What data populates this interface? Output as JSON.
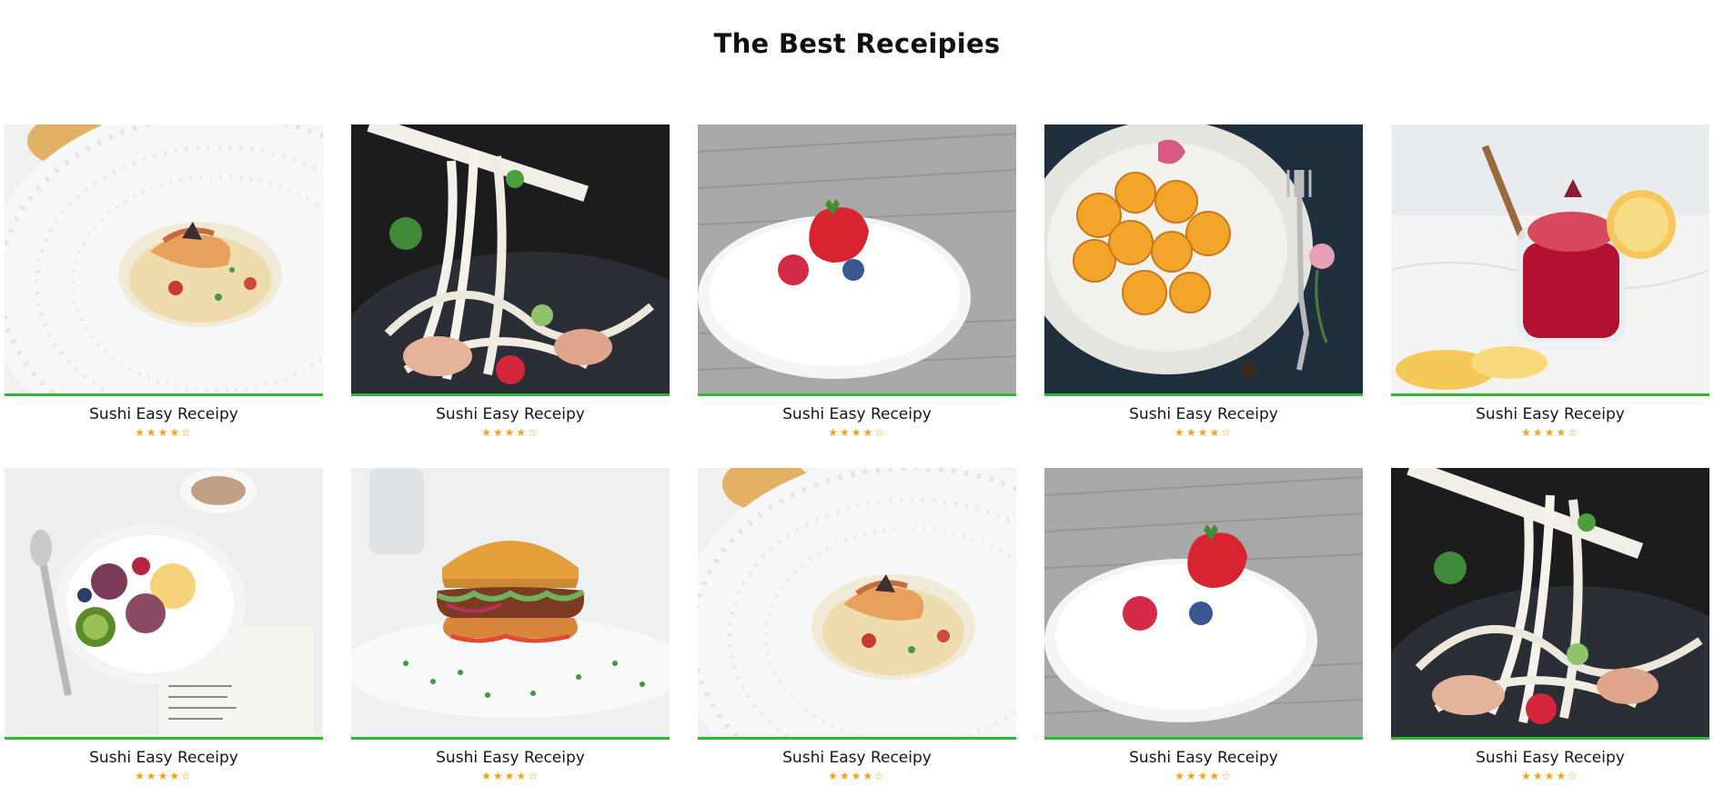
{
  "page": {
    "title": "The Best Receipies"
  },
  "theme": {
    "accent": "#2fb836",
    "star": "#f3a21c"
  },
  "cards": [
    {
      "title": "Sushi Easy Receipy",
      "image": "shrimp-curry-plate",
      "rating": 4,
      "max": 5,
      "stars_on": "★★★★",
      "stars_off": "☆"
    },
    {
      "title": "Sushi Easy Receipy",
      "image": "udon-noodles",
      "rating": 4,
      "max": 5,
      "stars_on": "★★★★",
      "stars_off": "☆"
    },
    {
      "title": "Sushi Easy Receipy",
      "image": "berries-plate",
      "rating": 4,
      "max": 5,
      "stars_on": "★★★★",
      "stars_off": "☆"
    },
    {
      "title": "Sushi Easy Receipy",
      "image": "apricot-plate",
      "rating": 4,
      "max": 5,
      "stars_on": "★★★★",
      "stars_off": "☆"
    },
    {
      "title": "Sushi Easy Receipy",
      "image": "berry-smoothie-jar",
      "rating": 4,
      "max": 5,
      "stars_on": "★★★★",
      "stars_off": "☆"
    },
    {
      "title": "Sushi Easy Receipy",
      "image": "fruit-bowl",
      "rating": 4,
      "max": 5,
      "stars_on": "★★★★",
      "stars_off": "☆"
    },
    {
      "title": "Sushi Easy Receipy",
      "image": "burger",
      "rating": 4,
      "max": 5,
      "stars_on": "★★★★",
      "stars_off": "☆"
    },
    {
      "title": "Sushi Easy Receipy",
      "image": "shrimp-curry-plate",
      "rating": 4,
      "max": 5,
      "stars_on": "★★★★",
      "stars_off": "☆"
    },
    {
      "title": "Sushi Easy Receipy",
      "image": "berries-plate",
      "rating": 4,
      "max": 5,
      "stars_on": "★★★★",
      "stars_off": "☆"
    },
    {
      "title": "Sushi Easy Receipy",
      "image": "udon-noodles",
      "rating": 4,
      "max": 5,
      "stars_on": "★★★★",
      "stars_off": "☆"
    }
  ]
}
